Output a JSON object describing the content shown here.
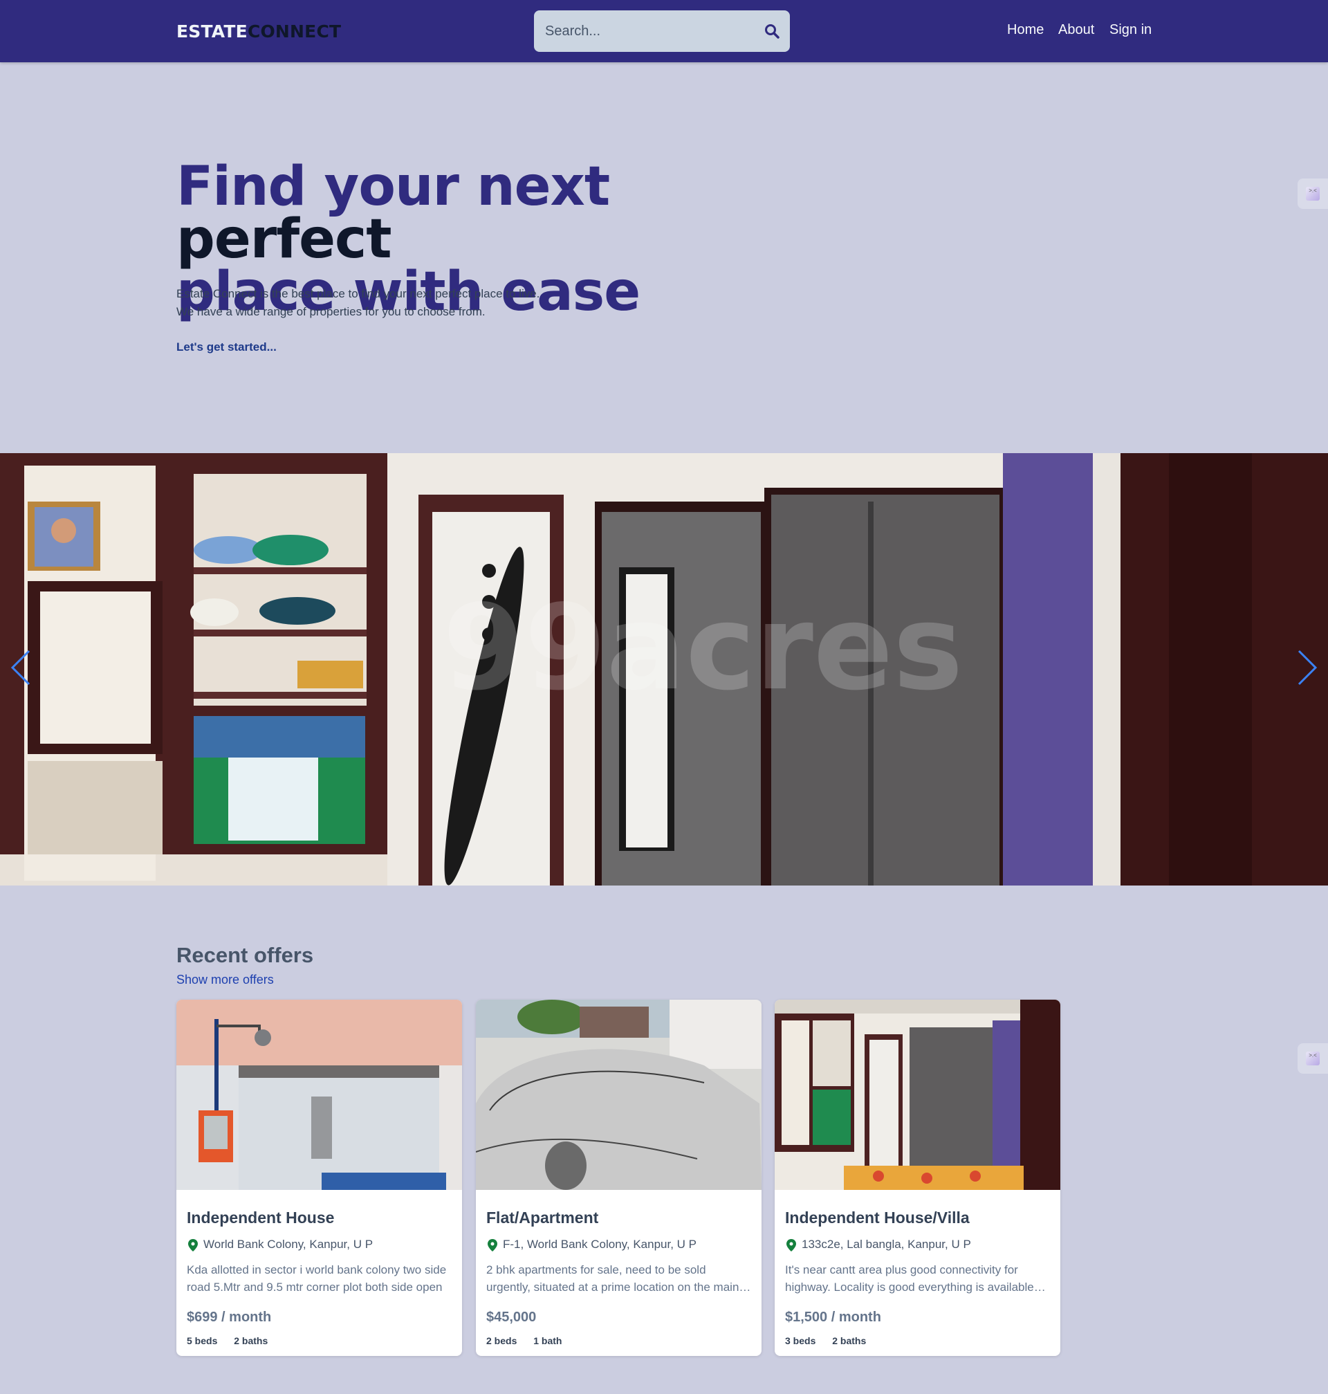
{
  "header": {
    "logo_part1": "ESTATE",
    "logo_part2": "CONNECT",
    "search_placeholder": "Search...",
    "nav": {
      "home": "Home",
      "about": "About",
      "signin": "Sign in"
    },
    "background_color": "#302b7f"
  },
  "hero": {
    "title_part1": "Find your next",
    "title_part2": "perfect",
    "title_part3": "place with ease",
    "description_line1": "Estate Connect is the best place to find your next perfect place to live.",
    "description_line2": "We have a wide range of properties for you to choose from.",
    "cta": "Let's get started..."
  },
  "carousel": {
    "watermark": "99acres",
    "prev_icon": "chevron-left-icon",
    "next_icon": "chevron-right-icon"
  },
  "offers": {
    "title": "Recent offers",
    "show_more": "Show more offers",
    "cards": [
      {
        "title": "Independent House",
        "address": "World Bank Colony, Kanpur, U P",
        "description": "Kda allotted in sector i world bank colony two side road 5.Mtr and 9.5 mtr corner plot both side open",
        "price": "$699 / month",
        "beds": "5 beds",
        "baths": "2 baths"
      },
      {
        "title": "Flat/Apartment",
        "address": "F-1, World Bank Colony, Kanpur, U P",
        "description": "2 bhk apartments for sale, need to be sold urgently, situated at a prime location on the main road",
        "price": "$45,000",
        "beds": "2 beds",
        "baths": "1 bath"
      },
      {
        "title": "Independent House/Villa",
        "address": "133c2e, Lal bangla, Kanpur, U P",
        "description": "It's near cantt area plus good connectivity for highway. Locality is good everything is available nearby",
        "price": "$1,500 / month",
        "beds": "3 beds",
        "baths": "2 baths"
      }
    ]
  },
  "colors": {
    "page_bg": "#cbcde0",
    "accent": "#302b7f",
    "link": "#1e40af",
    "pin": "#15803d"
  }
}
